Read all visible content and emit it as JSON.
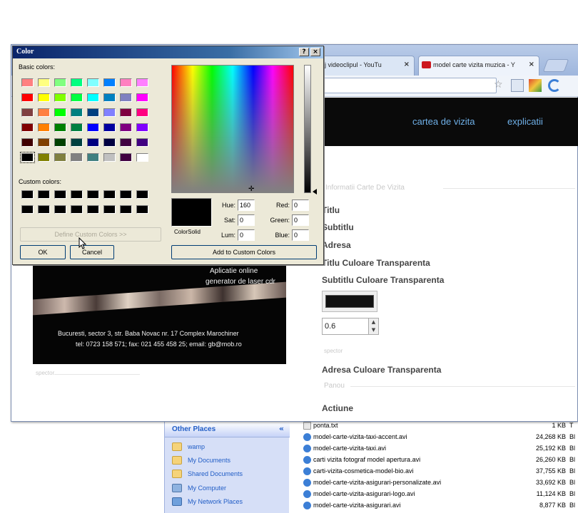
{
  "explorer": {
    "other_places": {
      "title": "Other Places",
      "collapse_glyph": "«",
      "items": [
        {
          "label": "wamp",
          "icon": "folder-icon"
        },
        {
          "label": "My Documents",
          "icon": "my-documents-icon"
        },
        {
          "label": "Shared Documents",
          "icon": "shared-documents-icon"
        },
        {
          "label": "My Computer",
          "icon": "my-computer-icon"
        },
        {
          "label": "My Network Places",
          "icon": "network-places-icon"
        }
      ]
    },
    "files": [
      {
        "name": "ponta.txt",
        "size": "1 KB",
        "type": "T"
      },
      {
        "name": "model-carte-vizita-taxi-accent.avi",
        "size": "24,268 KB",
        "type": "Bl"
      },
      {
        "name": "model-carte-vizita-taxi.avi",
        "size": "25,192 KB",
        "type": "Bl"
      },
      {
        "name": "carti vizita fotograf model apertura.avi",
        "size": "26,260 KB",
        "type": "Bl"
      },
      {
        "name": "carti-vizita-cosmetica-model-bio.avi",
        "size": "37,755 KB",
        "type": "Bl"
      },
      {
        "name": "model-carte-vizita-asigurari-personalizate.avi",
        "size": "33,692 KB",
        "type": "Bl"
      },
      {
        "name": "model-carte-vizita-asigurari-logo.avi",
        "size": "11,124 KB",
        "type": "Bl"
      },
      {
        "name": "model-carte-vizita-asigurari.avi",
        "size": "8,877 KB",
        "type": "Bl"
      }
    ]
  },
  "browser": {
    "tabs": [
      {
        "title": "aj videoclipul - YouTu",
        "close": "×"
      },
      {
        "title": "model carte vizita muzica - Y",
        "close": "×"
      }
    ],
    "nav": {
      "link1": "cartea de vizita",
      "link2": "explicatii"
    },
    "form": {
      "legend": "Informatii Carte De Vizita",
      "labels": {
        "titlu": "Titlu",
        "subtitlu": "Subtitlu",
        "adresa": "Adresa",
        "titlu_culoare": "Titlu Culoare Transparenta",
        "subtitlu_culoare": "Subtitlu Culoare Transparenta",
        "adresa_culoare": "Adresa Culoare Transparenta",
        "actiune": "Actiune"
      },
      "opacity_value": "0.6",
      "small_label": "spector",
      "legend2": "Panou"
    },
    "card": {
      "line1": "Aplicatie online",
      "line2": "generator de laser cdr",
      "address": "Bucuresti, sector 3, str. Baba Novac nr. 17 Complex Marochiner",
      "contact": "tel: 0723 158 571; fax: 021 455 458 25; email: gb@mob.ro",
      "footer_small": "spector"
    }
  },
  "color_dialog": {
    "title": "Color",
    "help_btn": "?",
    "close_btn": "×",
    "basic_colors_label": "Basic colors:",
    "custom_colors_label": "Custom colors:",
    "basic_colors": [
      [
        "#ff8080",
        "#ffff80",
        "#80ff80",
        "#00ff80",
        "#80ffff",
        "#0080ff",
        "#ff80c0",
        "#ff80ff"
      ],
      [
        "#ff0000",
        "#ffff00",
        "#80ff00",
        "#00ff40",
        "#00ffff",
        "#0080c0",
        "#8080c0",
        "#ff00ff"
      ],
      [
        "#804040",
        "#ff8040",
        "#00ff00",
        "#008080",
        "#004080",
        "#8080ff",
        "#800040",
        "#ff0080"
      ],
      [
        "#800000",
        "#ff8000",
        "#008000",
        "#008040",
        "#0000ff",
        "#0000a0",
        "#800080",
        "#8000ff"
      ],
      [
        "#400000",
        "#804000",
        "#004000",
        "#004040",
        "#000080",
        "#000040",
        "#400040",
        "#400080"
      ],
      [
        "#000000",
        "#808000",
        "#808040",
        "#808080",
        "#408080",
        "#c0c0c0",
        "#400040",
        "#ffffff"
      ]
    ],
    "define_custom_btn": "Define Custom Colors >>",
    "ok_btn": "OK",
    "cancel_btn": "Cancel",
    "color_solid_label": "Color|Solid",
    "hue_label": "Hue:",
    "hue_value": "160",
    "sat_label": "Sat:",
    "sat_value": "0",
    "lum_label": "Lum:",
    "lum_value": "0",
    "red_label": "Red:",
    "red_value": "0",
    "green_label": "Green:",
    "green_value": "0",
    "blue_label": "Blue:",
    "blue_value": "0",
    "add_custom_btn": "Add to Custom Colors",
    "selected_color": "#000000"
  }
}
